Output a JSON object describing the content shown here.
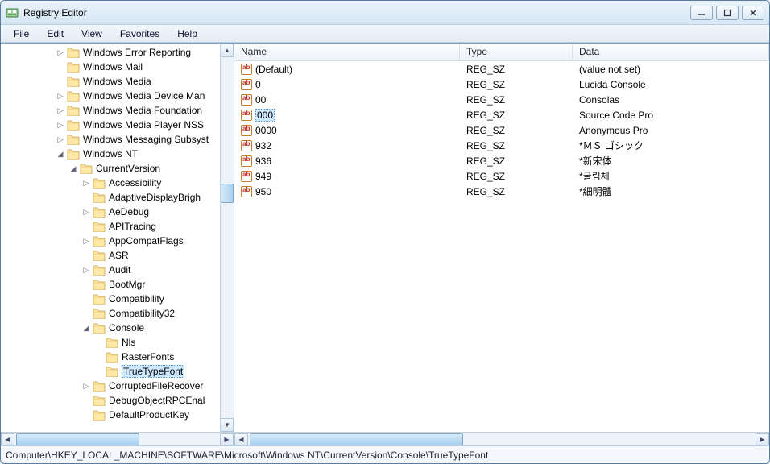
{
  "window": {
    "title": "Registry Editor"
  },
  "menu": {
    "file": "File",
    "edit": "Edit",
    "view": "View",
    "favorites": "Favorites",
    "help": "Help"
  },
  "tree": {
    "items": [
      {
        "indent": 4,
        "expander": "▷",
        "label": "Windows Error Reporting"
      },
      {
        "indent": 4,
        "expander": "",
        "label": "Windows Mail"
      },
      {
        "indent": 4,
        "expander": "",
        "label": "Windows Media"
      },
      {
        "indent": 4,
        "expander": "▷",
        "label": "Windows Media Device Man"
      },
      {
        "indent": 4,
        "expander": "▷",
        "label": "Windows Media Foundation"
      },
      {
        "indent": 4,
        "expander": "▷",
        "label": "Windows Media Player NSS"
      },
      {
        "indent": 4,
        "expander": "▷",
        "label": "Windows Messaging Subsyst"
      },
      {
        "indent": 4,
        "expander": "◢",
        "label": "Windows NT"
      },
      {
        "indent": 5,
        "expander": "◢",
        "label": "CurrentVersion"
      },
      {
        "indent": 6,
        "expander": "▷",
        "label": "Accessibility"
      },
      {
        "indent": 6,
        "expander": "",
        "label": "AdaptiveDisplayBrigh"
      },
      {
        "indent": 6,
        "expander": "▷",
        "label": "AeDebug"
      },
      {
        "indent": 6,
        "expander": "",
        "label": "APITracing"
      },
      {
        "indent": 6,
        "expander": "▷",
        "label": "AppCompatFlags"
      },
      {
        "indent": 6,
        "expander": "",
        "label": "ASR"
      },
      {
        "indent": 6,
        "expander": "▷",
        "label": "Audit"
      },
      {
        "indent": 6,
        "expander": "",
        "label": "BootMgr"
      },
      {
        "indent": 6,
        "expander": "",
        "label": "Compatibility"
      },
      {
        "indent": 6,
        "expander": "",
        "label": "Compatibility32"
      },
      {
        "indent": 6,
        "expander": "◢",
        "label": "Console"
      },
      {
        "indent": 7,
        "expander": "",
        "label": "Nls"
      },
      {
        "indent": 7,
        "expander": "",
        "label": "RasterFonts"
      },
      {
        "indent": 7,
        "expander": "",
        "label": "TrueTypeFont",
        "selected": true
      },
      {
        "indent": 6,
        "expander": "▷",
        "label": "CorruptedFileRecover"
      },
      {
        "indent": 6,
        "expander": "",
        "label": "DebugObjectRPCEnal"
      },
      {
        "indent": 6,
        "expander": "",
        "label": "DefaultProductKey"
      }
    ]
  },
  "columns": {
    "name": "Name",
    "type": "Type",
    "data": "Data"
  },
  "values": [
    {
      "name": "(Default)",
      "type": "REG_SZ",
      "data": "(value not set)"
    },
    {
      "name": "0",
      "type": "REG_SZ",
      "data": "Lucida Console"
    },
    {
      "name": "00",
      "type": "REG_SZ",
      "data": "Consolas"
    },
    {
      "name": "000",
      "type": "REG_SZ",
      "data": "Source Code Pro",
      "selected": true
    },
    {
      "name": "0000",
      "type": "REG_SZ",
      "data": "Anonymous Pro"
    },
    {
      "name": "932",
      "type": "REG_SZ",
      "data": "*ＭＳ ゴシック"
    },
    {
      "name": "936",
      "type": "REG_SZ",
      "data": "*新宋体"
    },
    {
      "name": "949",
      "type": "REG_SZ",
      "data": "*굴림체"
    },
    {
      "name": "950",
      "type": "REG_SZ",
      "data": "*細明體"
    }
  ],
  "statusbar": {
    "path": "Computer\\HKEY_LOCAL_MACHINE\\SOFTWARE\\Microsoft\\Windows NT\\CurrentVersion\\Console\\TrueTypeFont"
  }
}
